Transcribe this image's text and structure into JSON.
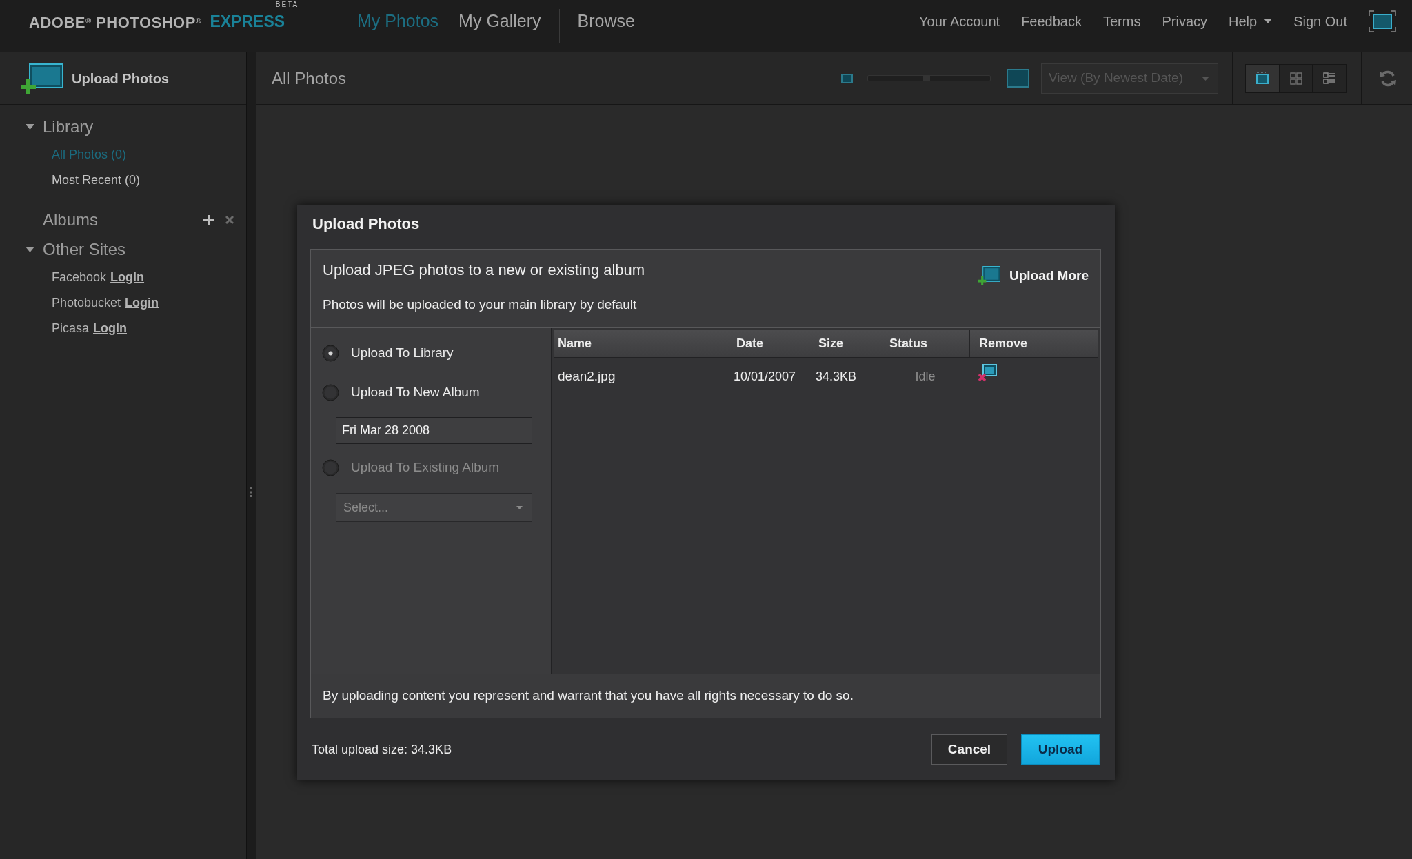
{
  "header": {
    "logo": {
      "brand": "ADOBE$^{®}$ PHOTOSHOP$^{®}$",
      "product": "EXPRESS",
      "badge": "BETA"
    },
    "nav_groups": [
      [
        {
          "label": "My Photos",
          "selected": true
        },
        {
          "label": "My Gallery",
          "selected": false
        }
      ],
      [
        {
          "label": "Browse",
          "selected": false
        }
      ]
    ],
    "links": [
      {
        "kind": "link",
        "label": "Your Account"
      },
      {
        "kind": "link",
        "label": "Feedback"
      },
      {
        "kind": "link",
        "label": "Terms"
      },
      {
        "kind": "link",
        "label": "Privacy"
      },
      {
        "kind": "menu",
        "label": "Help"
      },
      {
        "kind": "link",
        "label": "Sign Out"
      }
    ]
  },
  "sidebar": {
    "upload_button": "Upload Photos",
    "sections": [
      {
        "kind": "tree",
        "title": "Library",
        "expanded": true,
        "items": [
          {
            "label": "All Photos (0)",
            "selected": true
          },
          {
            "label": "Most Recent (0)",
            "selected": false
          }
        ]
      },
      {
        "kind": "albums",
        "title": "Albums"
      },
      {
        "kind": "tree",
        "title": "Other Sites",
        "expanded": true,
        "items": [
          {
            "site": "Facebook",
            "link": "Login"
          },
          {
            "site": "Photobucket",
            "link": "Login"
          },
          {
            "site": "Picasa",
            "link": "Login"
          }
        ]
      }
    ]
  },
  "main": {
    "title": "All Photos",
    "zoom_slider": {
      "level": 0.48
    },
    "view_select": {
      "value": "View (By Newest Date)",
      "disabled": true
    },
    "view_modes": [
      {
        "kind": "single",
        "selected": true
      },
      {
        "kind": "grid",
        "selected": false
      },
      {
        "kind": "list",
        "selected": false
      }
    ]
  },
  "dialog": {
    "title": "Upload Photos",
    "heading": "Upload JPEG photos to a new or existing album",
    "subheading": "Photos will be uploaded to your main library by default",
    "upload_more": "Upload More",
    "destinations": [
      {
        "label": "Upload To Library",
        "selected": true,
        "disabled": false
      },
      {
        "label": "Upload To New Album",
        "selected": false,
        "disabled": false,
        "field": {
          "kind": "text",
          "value": "Fri Mar 28 2008"
        }
      },
      {
        "label": "Upload To Existing Album",
        "selected": false,
        "disabled": true,
        "field": {
          "kind": "select",
          "placeholder": "Select..."
        }
      }
    ],
    "table": {
      "columns": [
        "Name",
        "Date",
        "Size",
        "Status",
        "Remove"
      ],
      "rows": [
        {
          "name": "dean2.jpg",
          "date": "10/01/2007",
          "size": "34.3KB",
          "status": "Idle"
        }
      ]
    },
    "notice": "By uploading content you represent and warrant that you have all rights necessary to do so.",
    "total": "Total upload size: 34.3KB",
    "buttons": [
      {
        "kind": "secondary",
        "label": "Cancel"
      },
      {
        "kind": "primary",
        "label": "Upload"
      }
    ]
  }
}
